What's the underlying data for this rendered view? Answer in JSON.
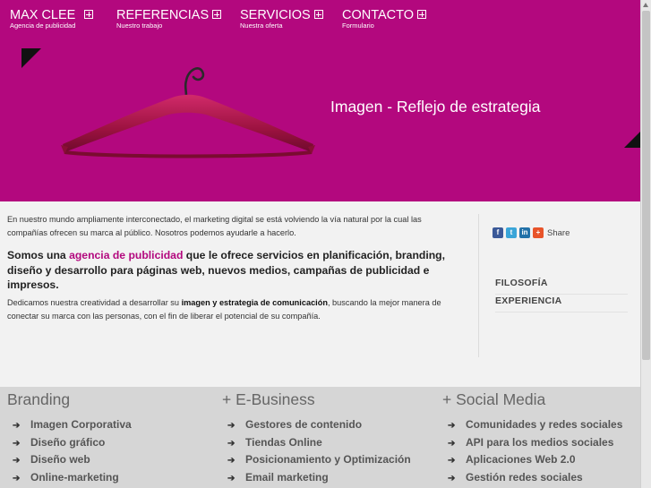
{
  "nav": {
    "brand": {
      "label": "MAX CLEE",
      "sub": "Agencia de publicidad"
    },
    "items": [
      {
        "label": "REFERENCIAS",
        "sub": "Nuestro trabajo"
      },
      {
        "label": "SERVICIOS",
        "sub": "Nuestra oferta"
      },
      {
        "label": "CONTACTO",
        "sub": "Formulario"
      }
    ]
  },
  "hero": {
    "tagline": "Imagen - Reflejo de estrategia",
    "background": "#b3087e"
  },
  "content": {
    "intro": "En nuestro mundo ampliamente interconectado, el marketing digital se está volviendo la vía natural por la cual las compañías ofrecen su marca al público. Nosotros podemos ayudarle a hacerlo.",
    "lead_before": "Somos una ",
    "lead_accent": "agencia de publicidad",
    "lead_after": " que le ofrece servicios en planificación, branding, diseño y desarrollo para páginas web, nuevos medios, campañas de publicidad e impresos.",
    "body_before": "Dedicamos nuestra creatividad a desarrollar su ",
    "body_bold": "imagen y estrategia de comunicación",
    "body_after": ", buscando la mejor manera de conectar su marca con las personas, con el fin de liberar el potencial de su compañía."
  },
  "sidebar": {
    "share_label": "Share",
    "social_icons": [
      "facebook-icon",
      "twitter-icon",
      "linkedin-icon",
      "addthis-icon"
    ],
    "links": [
      "FILOSOFÍA",
      "EXPERIENCIA"
    ]
  },
  "footer": {
    "columns": [
      {
        "title": "Branding",
        "items": [
          "Imagen Corporativa",
          "Diseño gráfico",
          "Diseño web",
          "Online-marketing"
        ]
      },
      {
        "title": "+ E-Business",
        "items": [
          "Gestores de contenido",
          "Tiendas Online",
          "Posicionamiento y Optimización",
          "Email marketing"
        ]
      },
      {
        "title": "+ Social Media",
        "items": [
          "Comunidades y redes sociales",
          "API para los medios sociales",
          "Aplicaciones Web 2.0",
          "Gestión redes sociales"
        ]
      }
    ]
  },
  "colors": {
    "brand": "#b3087e",
    "footer_bg": "#d6d6d6",
    "content_bg": "#f2f2f2"
  }
}
